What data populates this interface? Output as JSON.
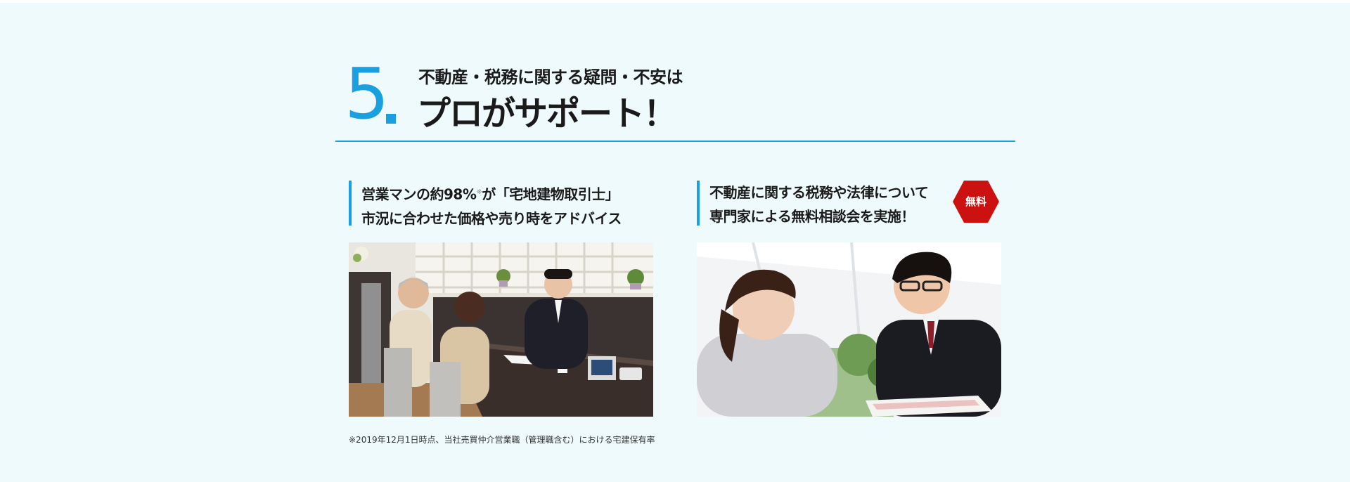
{
  "section": {
    "number": "5",
    "subtitle": "不動産・税務に関する疑問・不安は",
    "headline": "プロがサポート！",
    "accent_color": "#1a9fe0"
  },
  "columns": [
    {
      "title_line1_pre": "営業マンの約98%",
      "title_line1_mark": "※",
      "title_line1_post": "が「宅地建物取引士」",
      "title_line2": "市況に合わせた価格や売り時をアドバイス",
      "photo_subject": "consultation-office-photo"
    },
    {
      "title_line1": "不動産に関する税務や法律について",
      "title_line2": "専門家による無料相談会を実施！",
      "badge_label": "無料",
      "badge_color": "#cc1111",
      "photo_subject": "advisor-and-client-photo"
    }
  ],
  "footnote": "※2019年12月1日時点、当社売買仲介営業職（管理職含む）における宅建保有率"
}
